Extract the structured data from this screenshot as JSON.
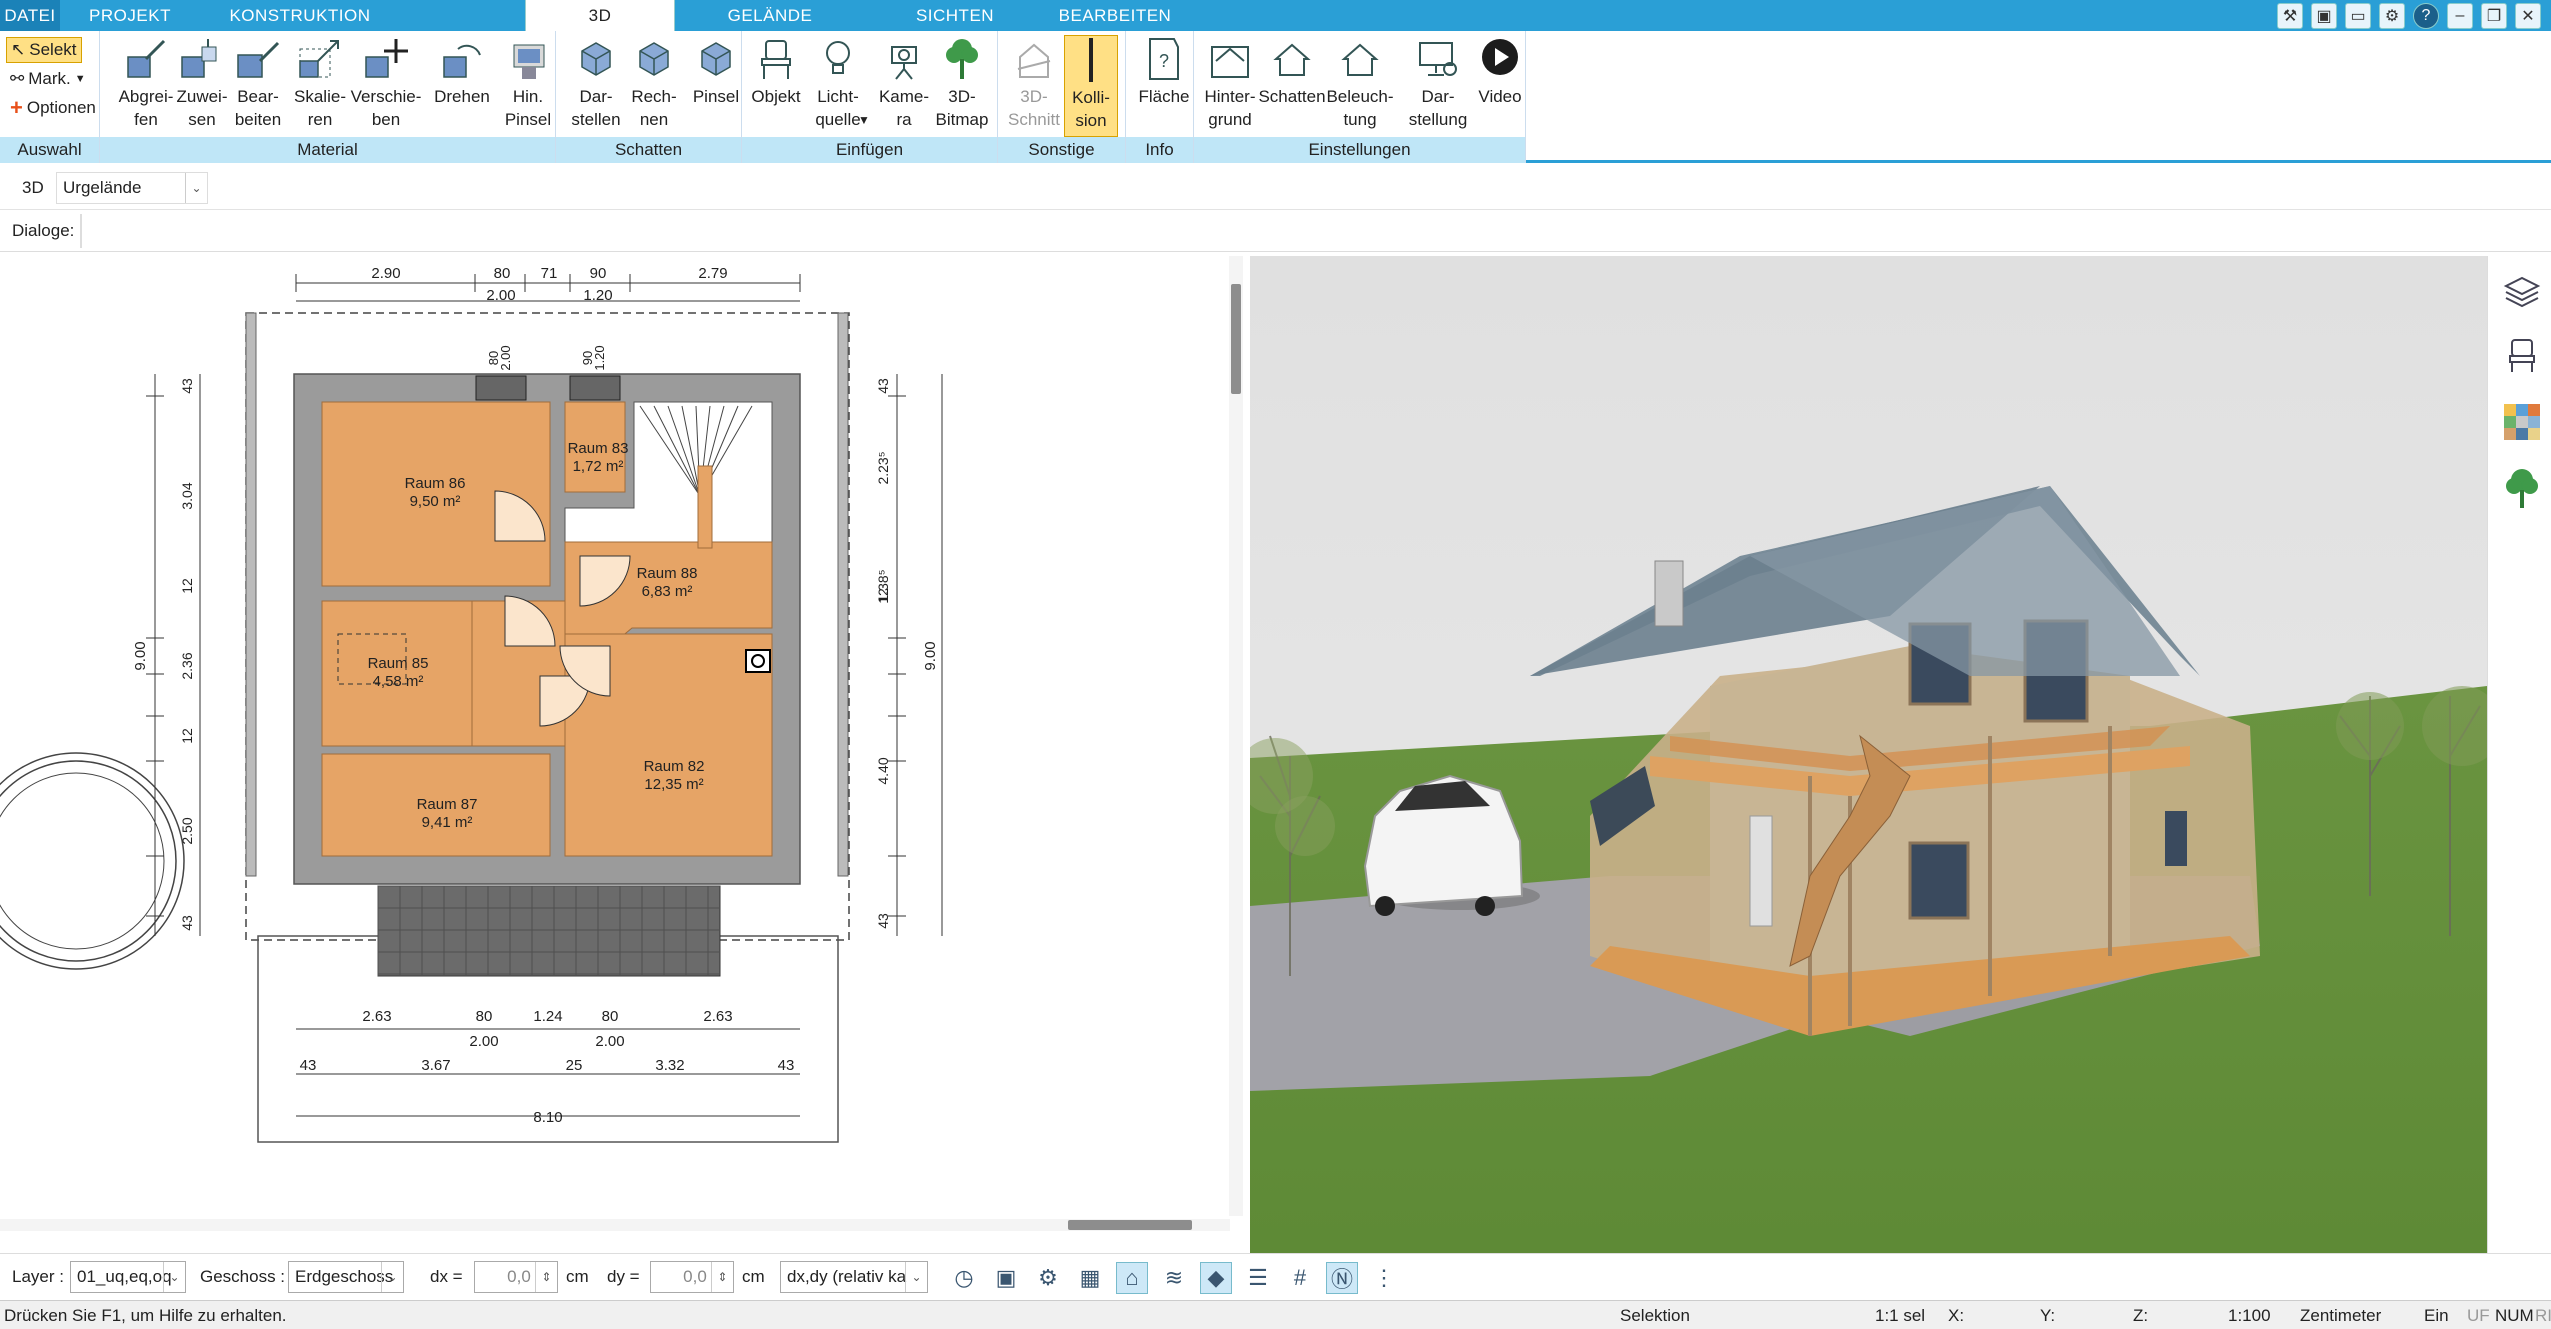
{
  "tabs": [
    "DATEI",
    "PROJEKT",
    "KONSTRUKTION",
    "3D",
    "GELÄNDE",
    "SICHTEN",
    "BEARBEITEN"
  ],
  "active_tab": "3D",
  "auswahl": {
    "label": "Auswahl",
    "selekt": "Selekt",
    "mark": "Mark.",
    "optionen": "Optionen"
  },
  "groups": {
    "material": "Material",
    "schatten": "Schatten",
    "einfuegen": "Einfügen",
    "sonstige": "Sonstige",
    "info": "Info",
    "einstellungen": "Einstellungen"
  },
  "buttons": {
    "abgreifen": [
      "Abgrei-",
      "fen"
    ],
    "zuweisen": [
      "Zuwei-",
      "sen"
    ],
    "bearbeiten": [
      "Bear-",
      "beiten"
    ],
    "skalieren": [
      "Skalie-",
      "ren"
    ],
    "verschieben": [
      "Verschie-",
      "ben"
    ],
    "drehen": [
      "Drehen",
      ""
    ],
    "hin_pinsel": [
      "Hin.",
      "Pinsel"
    ],
    "darstellen": [
      "Dar-",
      "stellen"
    ],
    "rechnen": [
      "Rech-",
      "nen"
    ],
    "pinsel": [
      "Pinsel",
      ""
    ],
    "objekt": [
      "Objekt",
      ""
    ],
    "lichtquelle": [
      "Licht-",
      "quelle"
    ],
    "kamera": [
      "Kame-",
      "ra"
    ],
    "bitmap": [
      "3D-",
      "Bitmap"
    ],
    "schnitt": [
      "3D-",
      "Schnitt"
    ],
    "kollision": [
      "Kolli-",
      "sion"
    ],
    "flaeche": [
      "Fläche",
      ""
    ],
    "hintergrund": [
      "Hinter-",
      "grund"
    ],
    "schatten": [
      "Schatten",
      ""
    ],
    "beleuchtung": [
      "Beleuch-",
      "tung"
    ],
    "darstellung": [
      "Dar-",
      "stellung"
    ],
    "video": [
      "Video",
      ""
    ]
  },
  "view_row": {
    "mode": "3D",
    "terrain": "Urgelände"
  },
  "dialoge_label": "Dialoge:",
  "plan": {
    "rooms": [
      {
        "name": "Raum 86",
        "area": "9,50 m²"
      },
      {
        "name": "Raum 83",
        "area": "1,72 m²"
      },
      {
        "name": "Raum 88",
        "area": "6,83 m²"
      },
      {
        "name": "Raum 85",
        "area": "4,58 m²"
      },
      {
        "name": "Raum 82",
        "area": "12,35 m²"
      },
      {
        "name": "Raum 87",
        "area": "9,41 m²"
      }
    ],
    "dims_top": [
      "2.90",
      "80",
      "71",
      "90",
      "2.79"
    ],
    "dims_top2": [
      "2.00",
      "1.20"
    ],
    "dims_left": [
      "9.00",
      "43",
      "3.04",
      "12",
      "2.36",
      "12",
      "2.50",
      "43"
    ],
    "dims_right": [
      "9.00",
      "43",
      "2.23⁵",
      "12",
      "1.38⁵",
      "4.40",
      "43"
    ],
    "dims_bottom1": [
      "2.63",
      "80",
      "1.24",
      "80",
      "2.63"
    ],
    "dims_bottom2": [
      "2.00",
      "2.00"
    ],
    "dims_bottom3": [
      "43",
      "3.67",
      "25",
      "3.32",
      "43"
    ],
    "dims_total": "8.10",
    "door_labels": [
      "80",
      "2.00",
      "90",
      "1.20"
    ]
  },
  "statusbar": {
    "layer_label": "Layer :",
    "layer_value": "01_uq,eq,oq",
    "geschoss_label": "Geschoss :",
    "geschoss_value": "Erdgeschoss",
    "dx_label": "dx =",
    "dx_value": "0,0",
    "dx_unit": "cm",
    "dy_label": "dy =",
    "dy_value": "0,0",
    "dy_unit": "cm",
    "rel_value": "dx,dy (relativ ka",
    "hint": "Drücken Sie F1, um Hilfe zu erhalten.",
    "mode": "Selektion",
    "sel": "1:1 sel",
    "x": "X:",
    "y": "Y:",
    "z": "Z:",
    "scale": "1:100",
    "unit": "Zentimeter",
    "ein": "Ein",
    "uf": "UF",
    "num": "NUM",
    "ri": "RI"
  },
  "colors": {
    "accent": "#2a9fd6",
    "floor": "#e6a466",
    "wall": "#9b9b9b",
    "grass": "#6e9640"
  }
}
